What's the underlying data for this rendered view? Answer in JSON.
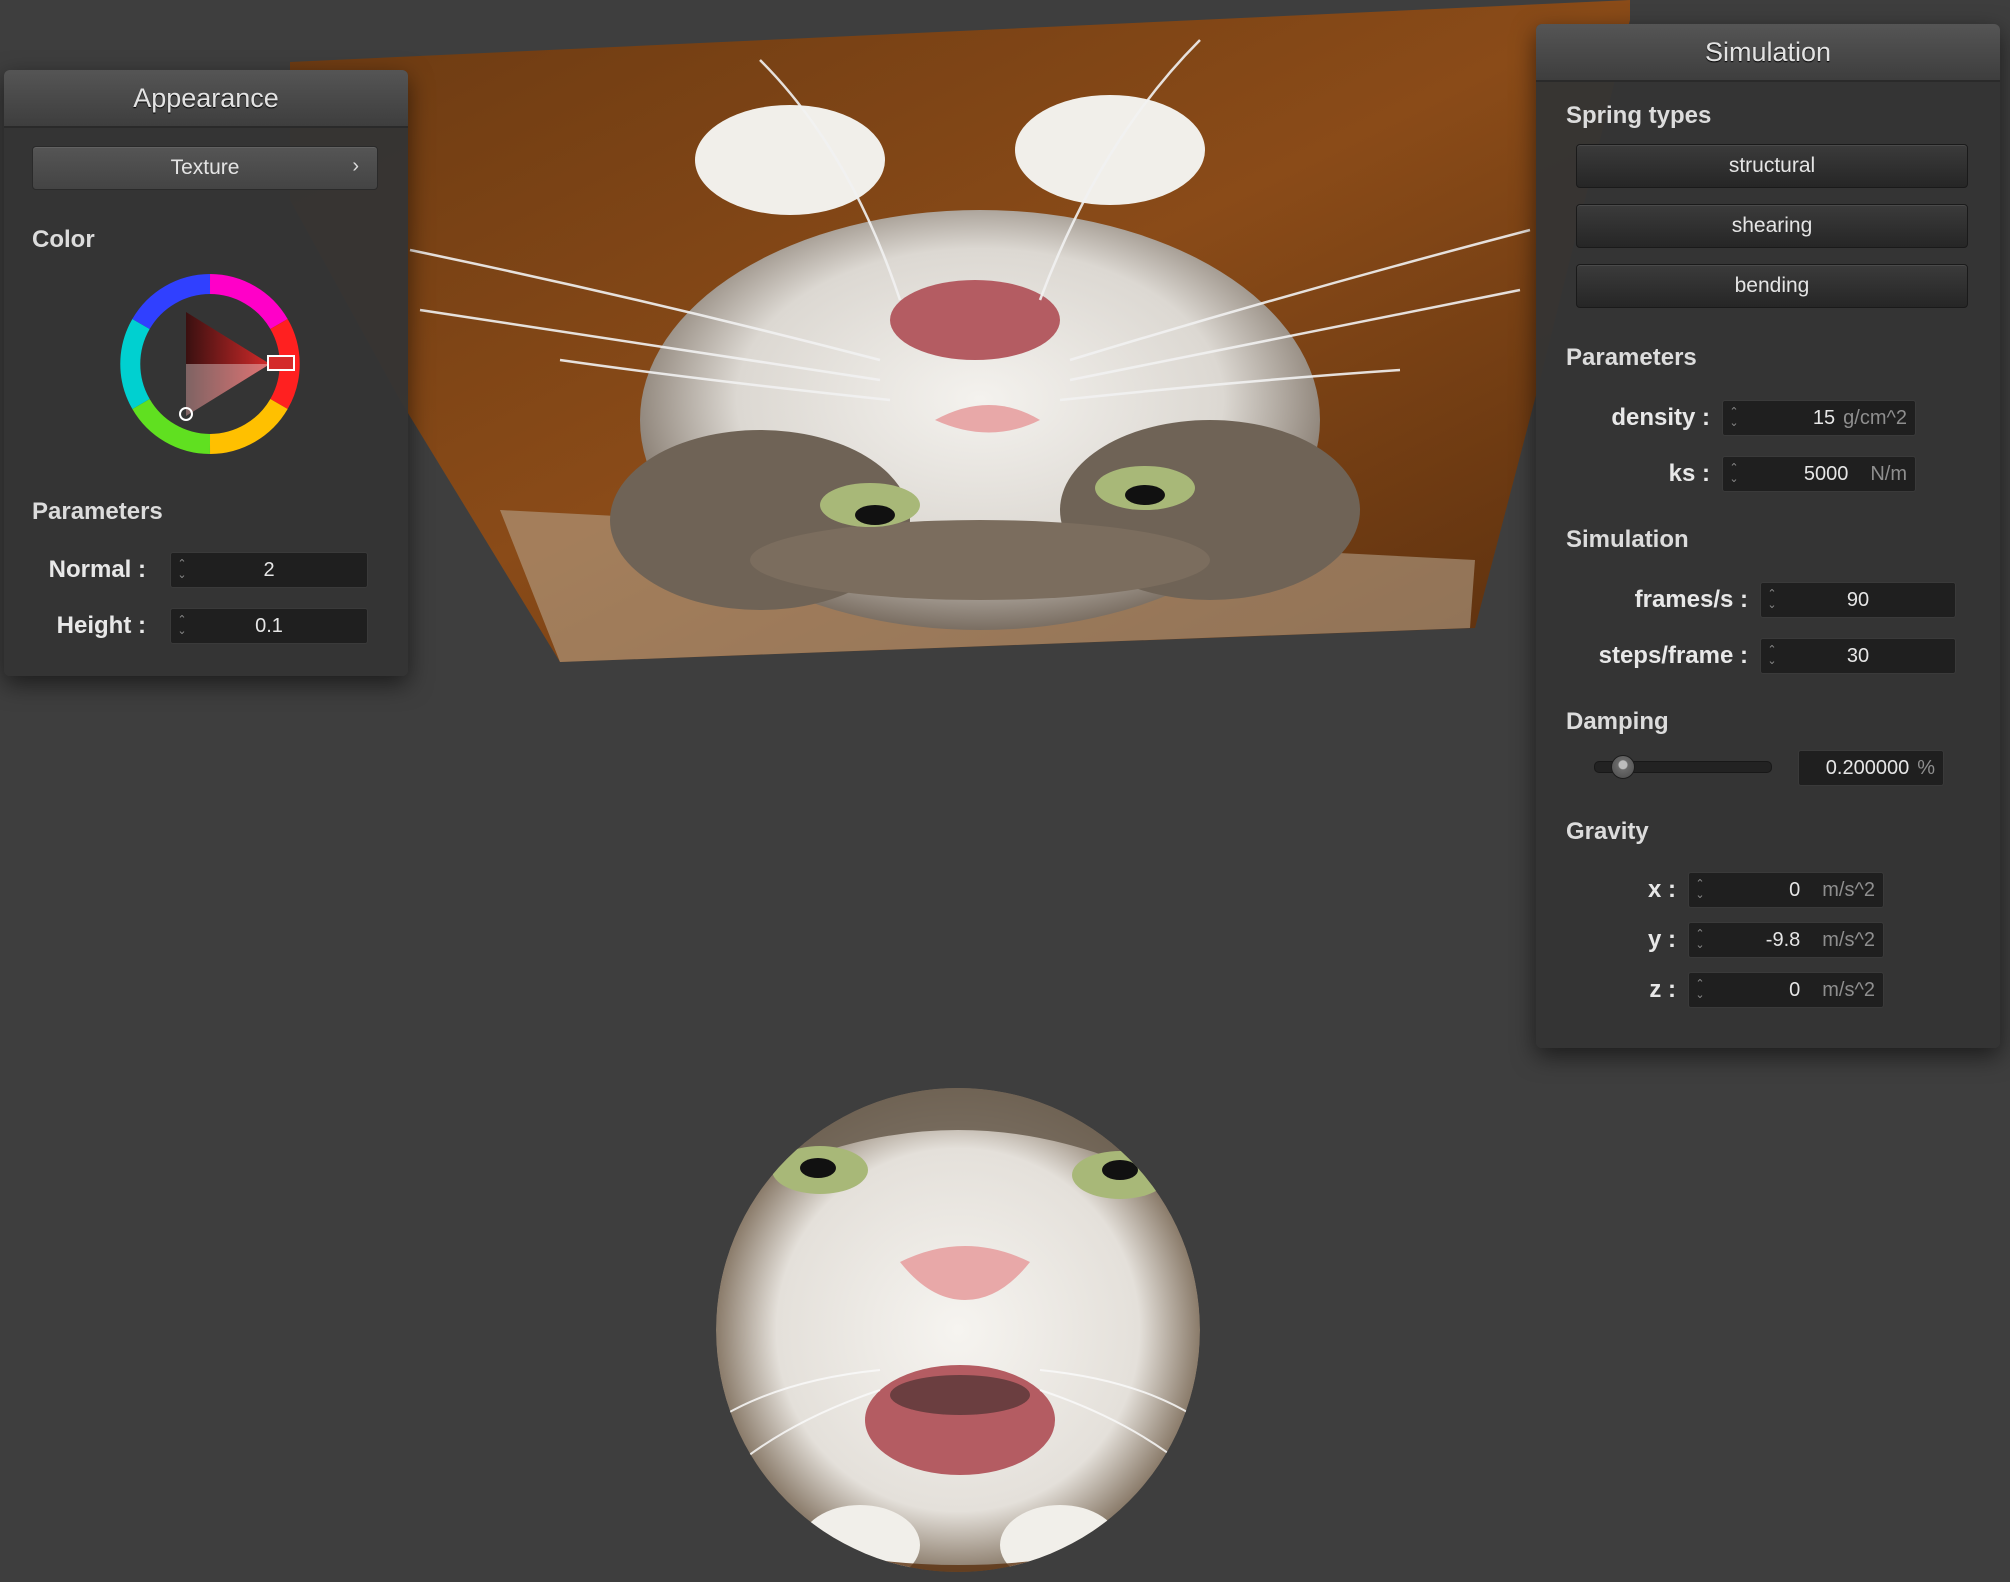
{
  "appearance": {
    "title": "Appearance",
    "texture_button": "Texture",
    "color_label": "Color",
    "parameters_label": "Parameters",
    "normal_label": "Normal :",
    "normal_value": "2",
    "height_label": "Height :",
    "height_value": "0.1",
    "chevron_glyph": "›"
  },
  "simulation_panel": {
    "title": "Simulation",
    "spring_types_label": "Spring types",
    "spring_buttons": [
      "structural",
      "shearing",
      "bending"
    ],
    "parameters_label": "Parameters",
    "density_label": "density :",
    "density_value": "15",
    "density_unit": "g/cm^2",
    "ks_label": "ks :",
    "ks_value": "5000",
    "ks_unit": "N/m",
    "simulation_label": "Simulation",
    "fps_label": "frames/s :",
    "fps_value": "90",
    "steps_label": "steps/frame :",
    "steps_value": "30",
    "damping_label": "Damping",
    "damping_value": "0.200000",
    "damping_unit": "%",
    "damping_fraction": 0.2,
    "gravity_label": "Gravity",
    "gx_label": "x :",
    "gx_value": "0",
    "gy_label": "y :",
    "gy_value": "-9.8",
    "gz_label": "z :",
    "gz_value": "0",
    "gravity_unit": "m/s^2"
  },
  "icons": {
    "spinner": "spinner-arrows-icon",
    "chevron": "chevron-right-icon"
  },
  "colors": {
    "background": "#3e3e3e",
    "selected_color": "#d42a2a"
  }
}
